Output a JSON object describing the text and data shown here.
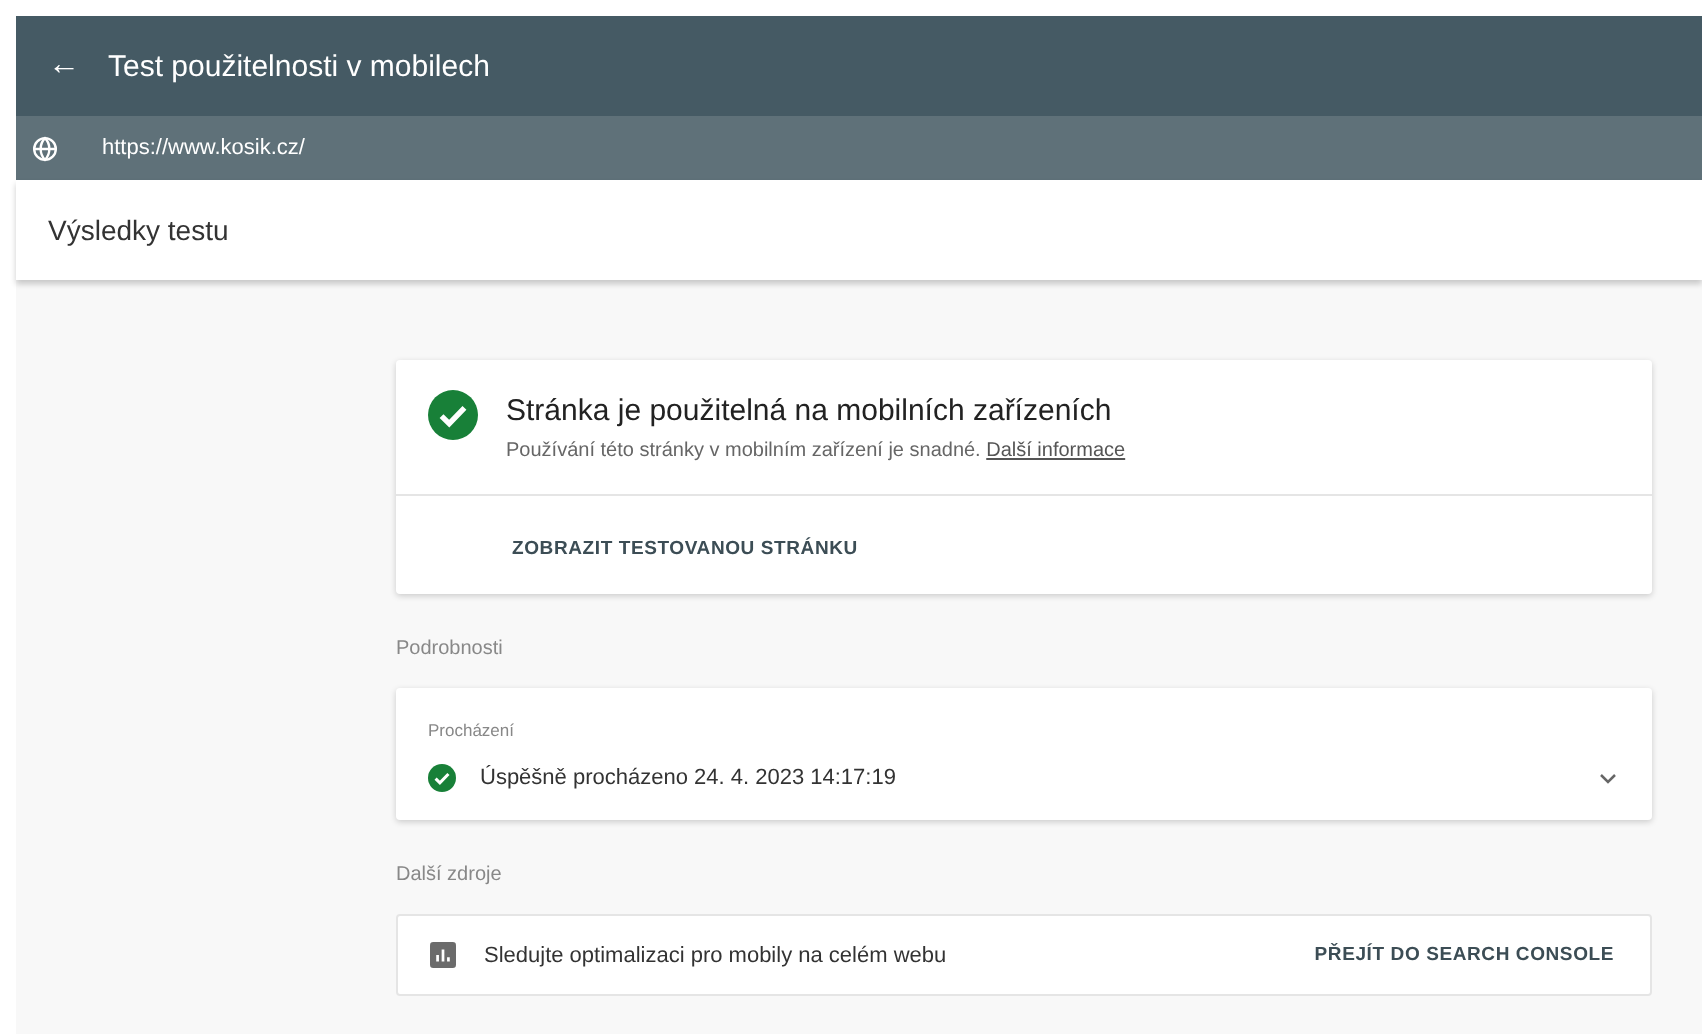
{
  "app_bar": {
    "back": "←",
    "title": "Test použitelnosti v mobilech"
  },
  "url_bar": {
    "url": "https://www.kosik.cz/"
  },
  "page_title": "Výsledky testu",
  "result": {
    "passed": true,
    "title": "Stránka je použitelná na mobilních zařízeních",
    "description": "Používání této stránky v mobilním zařízení je snadné.",
    "link": "Další informace",
    "action": "ZOBRAZIT TESTOVANOU STRÁNKU"
  },
  "details": {
    "heading": "Podrobnosti",
    "label": "Procházení",
    "passed": true,
    "text": "Úspěšně procházeno 24. 4. 2023 14:17:19",
    "expanded": false
  },
  "resources": {
    "heading": "Další zdroje",
    "text": "Sledujte optimalizaci pro mobily na celém webu",
    "action": "PŘEJÍT DO SEARCH CONSOLE"
  }
}
